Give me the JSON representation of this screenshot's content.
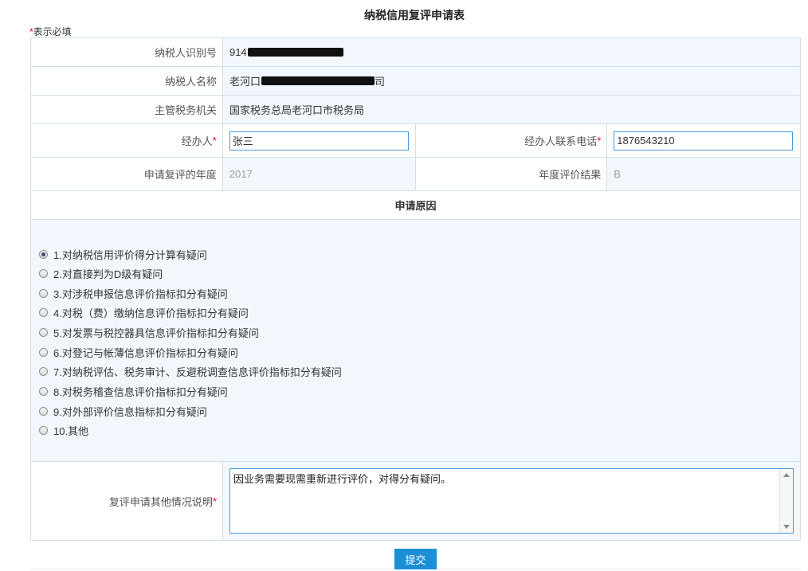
{
  "page_title": "纳税信用复评申请表",
  "required_note": "表示必填",
  "required_star": "*",
  "fields": {
    "taxpayer_id_label": "纳税人识别号",
    "taxpayer_id_value": "914",
    "taxpayer_name_label": "纳税人名称",
    "taxpayer_name_value": "老河口",
    "taxpayer_name_suffix": "司",
    "tax_authority_label": "主管税务机关",
    "tax_authority_value": "国家税务总局老河口市税务局",
    "handler_label": "经办人",
    "handler_value": "张三",
    "handler_phone_label": "经办人联系电话",
    "handler_phone_value": "1876543210",
    "review_year_label": "申请复评的年度",
    "review_year_value": "2017",
    "annual_result_label": "年度评价结果",
    "annual_result_value": "B"
  },
  "reasons_section": {
    "heading": "申请原因",
    "selected_index": 0,
    "options": [
      "1.对纳税信用评价得分计算有疑问",
      "2.对直接判为D级有疑问",
      "3.对涉税申报信息评价指标扣分有疑问",
      "4.对税（费）缴纳信息评价指标扣分有疑问",
      "5.对发票与税控器具信息评价指标扣分有疑问",
      "6.对登记与帐薄信息评价指标扣分有疑问",
      "7.对纳税评估、税务审计、反避税调查信息评价指标扣分有疑问",
      "8.对税务稽查信息评价指标扣分有疑问",
      "9.对外部评价信息指标扣分有疑问",
      "10.其他"
    ]
  },
  "description": {
    "label": "复评申请其他情况说明",
    "value": "因业务需要现需重新进行评价，对得分有疑问。"
  },
  "submit_label": "提交",
  "colors": {
    "accent": "#1a8fd8",
    "required": "#e60012",
    "row_fill": "#f1f7fd",
    "border": "#d2dfe9"
  }
}
